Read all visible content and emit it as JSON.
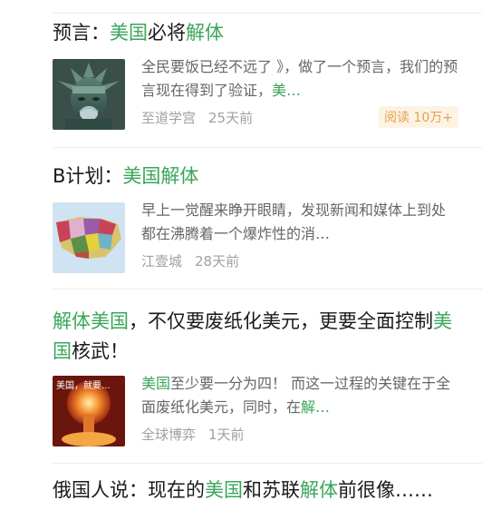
{
  "items": [
    {
      "title_parts": [
        {
          "text": "预言：",
          "hl": false
        },
        {
          "text": "美国",
          "hl": true
        },
        {
          "text": "必将",
          "hl": false
        },
        {
          "text": "解体",
          "hl": false
        }
      ],
      "snippet_parts": [
        {
          "text": "全民要饭已经不远了 》，做了一个预言，我们的预言现在得到了验证，",
          "hl": false
        },
        {
          "text": "美…",
          "hl": true
        }
      ],
      "author": "至道学宫",
      "time": "25天前",
      "badge": "阅读 10万+",
      "thumb_icon": "statue-of-liberty-icon"
    },
    {
      "title_parts": [
        {
          "text": "B计划：",
          "hl": false
        },
        {
          "text": "美国解体",
          "hl": true
        }
      ],
      "snippet_parts": [
        {
          "text": "早上一觉醒来睁开眼睛，发现新闻和媒体上到处都在沸腾着一个爆炸性的消…",
          "hl": false
        }
      ],
      "author": "江壹城",
      "time": "28天前",
      "badge": "",
      "thumb_icon": "usa-map-icon"
    },
    {
      "title_parts": [
        {
          "text": "解体",
          "hl": true
        },
        {
          "text": "美国",
          "hl": true
        },
        {
          "text": "，不仅要废纸化美元，更要全面控制",
          "hl": false
        },
        {
          "text": "美国",
          "hl": true
        },
        {
          "text": "核武！",
          "hl": false
        }
      ],
      "snippet_parts": [
        {
          "text": "美国",
          "hl": true
        },
        {
          "text": "至少要一分为四！ 而这一过程的关键在于全面废纸化美元，同时，在",
          "hl": false
        },
        {
          "text": "解…",
          "hl": true
        }
      ],
      "author": "全球博弈",
      "time": "1天前",
      "badge": "",
      "thumb_icon": "nuclear-explosion-icon"
    },
    {
      "title_parts": [
        {
          "text": "俄国人说：现在的",
          "hl": false
        },
        {
          "text": "美国",
          "hl": true
        },
        {
          "text": "和苏联",
          "hl": false
        },
        {
          "text": "解体",
          "hl": true
        },
        {
          "text": "前很像……",
          "hl": false
        }
      ]
    }
  ],
  "thumb3_overlay": "美国，就要..."
}
